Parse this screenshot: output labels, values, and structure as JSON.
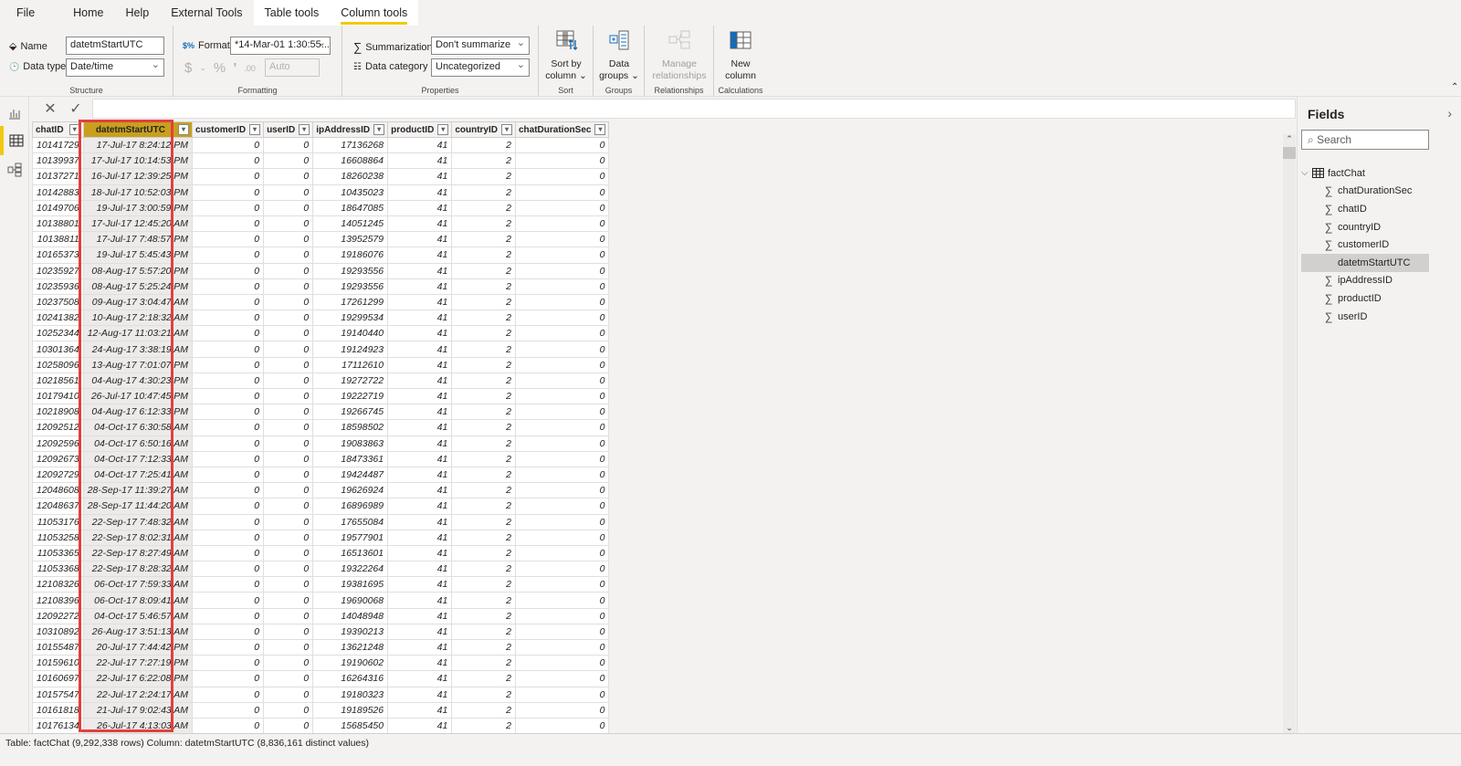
{
  "menu": {
    "tabs": [
      {
        "label": "File"
      },
      {
        "label": "Home"
      },
      {
        "label": "Help"
      },
      {
        "label": "External Tools"
      },
      {
        "label": "Table tools"
      },
      {
        "label": "Column tools"
      }
    ]
  },
  "ribbon": {
    "structure": {
      "name_label": "Name",
      "name_value": "datetmStartUTC",
      "datatype_label": "Data type",
      "datatype_value": "Date/time",
      "group_label": "Structure"
    },
    "formatting": {
      "format_label": "Format",
      "format_value": "*14-Mar-01 1:30:55...",
      "currency_symbol": "$",
      "percent_symbol": "%",
      "comma_symbol": "’",
      "decimals_value": "Auto",
      "group_label": "Formatting"
    },
    "properties": {
      "summarization_label": "Summarization",
      "summarization_value": "Don't summarize",
      "category_label": "Data category",
      "category_value": "Uncategorized",
      "group_label": "Properties"
    },
    "sort": {
      "button_line1": "Sort by",
      "button_line2": "column",
      "group_label": "Sort"
    },
    "groups": {
      "button_line1": "Data",
      "button_line2": "groups",
      "group_label": "Groups"
    },
    "relationships": {
      "button_line1": "Manage",
      "button_line2": "relationships",
      "group_label": "Relationships"
    },
    "calculations": {
      "button_line1": "New",
      "button_line2": "column",
      "group_label": "Calculations"
    }
  },
  "table": {
    "columns": [
      "chatID",
      "datetmStartUTC",
      "customerID",
      "userID",
      "ipAddressID",
      "productID",
      "countryID",
      "chatDurationSec"
    ],
    "selected_column": "datetmStartUTC",
    "rows": [
      [
        "10141729",
        "17-Jul-17 8:24:12 PM",
        "0",
        "0",
        "17136268",
        "41",
        "2",
        "0"
      ],
      [
        "10139937",
        "17-Jul-17 10:14:53 PM",
        "0",
        "0",
        "16608864",
        "41",
        "2",
        "0"
      ],
      [
        "10137271",
        "16-Jul-17 12:39:25 PM",
        "0",
        "0",
        "18260238",
        "41",
        "2",
        "0"
      ],
      [
        "10142883",
        "18-Jul-17 10:52:03 PM",
        "0",
        "0",
        "10435023",
        "41",
        "2",
        "0"
      ],
      [
        "10149706",
        "19-Jul-17 3:00:59 PM",
        "0",
        "0",
        "18647085",
        "41",
        "2",
        "0"
      ],
      [
        "10138801",
        "17-Jul-17 12:45:20 AM",
        "0",
        "0",
        "14051245",
        "41",
        "2",
        "0"
      ],
      [
        "10138811",
        "17-Jul-17 7:48:57 PM",
        "0",
        "0",
        "13952579",
        "41",
        "2",
        "0"
      ],
      [
        "10165373",
        "19-Jul-17 5:45:43 PM",
        "0",
        "0",
        "19186076",
        "41",
        "2",
        "0"
      ],
      [
        "10235927",
        "08-Aug-17 5:57:20 PM",
        "0",
        "0",
        "19293556",
        "41",
        "2",
        "0"
      ],
      [
        "10235936",
        "08-Aug-17 5:25:24 PM",
        "0",
        "0",
        "19293556",
        "41",
        "2",
        "0"
      ],
      [
        "10237508",
        "09-Aug-17 3:04:47 AM",
        "0",
        "0",
        "17261299",
        "41",
        "2",
        "0"
      ],
      [
        "10241382",
        "10-Aug-17 2:18:32 AM",
        "0",
        "0",
        "19299534",
        "41",
        "2",
        "0"
      ],
      [
        "10252344",
        "12-Aug-17 11:03:21 AM",
        "0",
        "0",
        "19140440",
        "41",
        "2",
        "0"
      ],
      [
        "10301364",
        "24-Aug-17 3:38:19 AM",
        "0",
        "0",
        "19124923",
        "41",
        "2",
        "0"
      ],
      [
        "10258096",
        "13-Aug-17 7:01:07 PM",
        "0",
        "0",
        "17112610",
        "41",
        "2",
        "0"
      ],
      [
        "10218561",
        "04-Aug-17 4:30:23 PM",
        "0",
        "0",
        "19272722",
        "41",
        "2",
        "0"
      ],
      [
        "10179410",
        "26-Jul-17 10:47:45 PM",
        "0",
        "0",
        "19222719",
        "41",
        "2",
        "0"
      ],
      [
        "10218908",
        "04-Aug-17 6:12:33 PM",
        "0",
        "0",
        "19266745",
        "41",
        "2",
        "0"
      ],
      [
        "12092512",
        "04-Oct-17 6:30:58 AM",
        "0",
        "0",
        "18598502",
        "41",
        "2",
        "0"
      ],
      [
        "12092596",
        "04-Oct-17 6:50:16 AM",
        "0",
        "0",
        "19083863",
        "41",
        "2",
        "0"
      ],
      [
        "12092673",
        "04-Oct-17 7:12:33 AM",
        "0",
        "0",
        "18473361",
        "41",
        "2",
        "0"
      ],
      [
        "12092729",
        "04-Oct-17 7:25:41 AM",
        "0",
        "0",
        "19424487",
        "41",
        "2",
        "0"
      ],
      [
        "12048608",
        "28-Sep-17 11:39:27 AM",
        "0",
        "0",
        "19626924",
        "41",
        "2",
        "0"
      ],
      [
        "12048637",
        "28-Sep-17 11:44:20 AM",
        "0",
        "0",
        "16896989",
        "41",
        "2",
        "0"
      ],
      [
        "11053176",
        "22-Sep-17 7:48:32 AM",
        "0",
        "0",
        "17655084",
        "41",
        "2",
        "0"
      ],
      [
        "11053258",
        "22-Sep-17 8:02:31 AM",
        "0",
        "0",
        "19577901",
        "41",
        "2",
        "0"
      ],
      [
        "11053365",
        "22-Sep-17 8:27:49 AM",
        "0",
        "0",
        "16513601",
        "41",
        "2",
        "0"
      ],
      [
        "11053368",
        "22-Sep-17 8:28:32 AM",
        "0",
        "0",
        "19322264",
        "41",
        "2",
        "0"
      ],
      [
        "12108326",
        "06-Oct-17 7:59:33 AM",
        "0",
        "0",
        "19381695",
        "41",
        "2",
        "0"
      ],
      [
        "12108396",
        "06-Oct-17 8:09:41 AM",
        "0",
        "0",
        "19690068",
        "41",
        "2",
        "0"
      ],
      [
        "12092272",
        "04-Oct-17 5:46:57 AM",
        "0",
        "0",
        "14048948",
        "41",
        "2",
        "0"
      ],
      [
        "10310892",
        "26-Aug-17 3:51:13 AM",
        "0",
        "0",
        "19390213",
        "41",
        "2",
        "0"
      ],
      [
        "10155487",
        "20-Jul-17 7:44:42 PM",
        "0",
        "0",
        "13621248",
        "41",
        "2",
        "0"
      ],
      [
        "10159610",
        "22-Jul-17 7:27:19 PM",
        "0",
        "0",
        "19190602",
        "41",
        "2",
        "0"
      ],
      [
        "10160697",
        "22-Jul-17 6:22:08 PM",
        "0",
        "0",
        "16264316",
        "41",
        "2",
        "0"
      ],
      [
        "10157547",
        "22-Jul-17 2:24:17 AM",
        "0",
        "0",
        "19180323",
        "41",
        "2",
        "0"
      ],
      [
        "10161818",
        "21-Jul-17 9:02:43 AM",
        "0",
        "0",
        "19189526",
        "41",
        "2",
        "0"
      ],
      [
        "10176134",
        "26-Jul-17 4:13:03 AM",
        "0",
        "0",
        "15685450",
        "41",
        "2",
        "0"
      ]
    ]
  },
  "fields_pane": {
    "title": "Fields",
    "search_placeholder": "Search",
    "table_name": "factChat",
    "fields": [
      {
        "name": "chatDurationSec",
        "icon": "sigma-icon",
        "selected": false
      },
      {
        "name": "chatID",
        "icon": "sigma-icon",
        "selected": false
      },
      {
        "name": "countryID",
        "icon": "sigma-icon",
        "selected": false
      },
      {
        "name": "customerID",
        "icon": "sigma-icon",
        "selected": false
      },
      {
        "name": "datetmStartUTC",
        "icon": "",
        "selected": true
      },
      {
        "name": "ipAddressID",
        "icon": "sigma-icon",
        "selected": false
      },
      {
        "name": "productID",
        "icon": "sigma-icon",
        "selected": false
      },
      {
        "name": "userID",
        "icon": "sigma-icon",
        "selected": false
      }
    ]
  },
  "status": {
    "text": "Table: factChat (9,292,338 rows) Column: datetmStartUTC (8,836,161 distinct values)"
  },
  "colors": {
    "accent": "#f2c811",
    "selected_header": "#c8a01e",
    "selection_outline": "#e2403c"
  }
}
